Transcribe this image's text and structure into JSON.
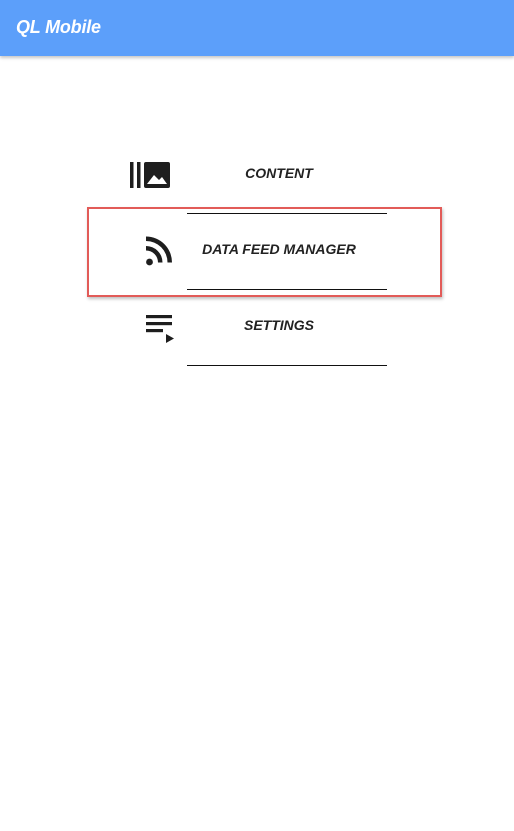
{
  "app": {
    "title": "QL Mobile"
  },
  "menu": {
    "items": [
      {
        "id": "content",
        "label": "CONTENT",
        "icon": "photo-library-icon"
      },
      {
        "id": "data-feed-manager",
        "label": "DATA FEED MANAGER",
        "icon": "rss-feed-icon"
      },
      {
        "id": "settings",
        "label": "SETTINGS",
        "icon": "playlist-play-icon"
      }
    ],
    "selected": "data-feed-manager"
  },
  "colors": {
    "appbar": "#5c9ffa",
    "highlight": "#e25b58",
    "text": "#222222"
  }
}
